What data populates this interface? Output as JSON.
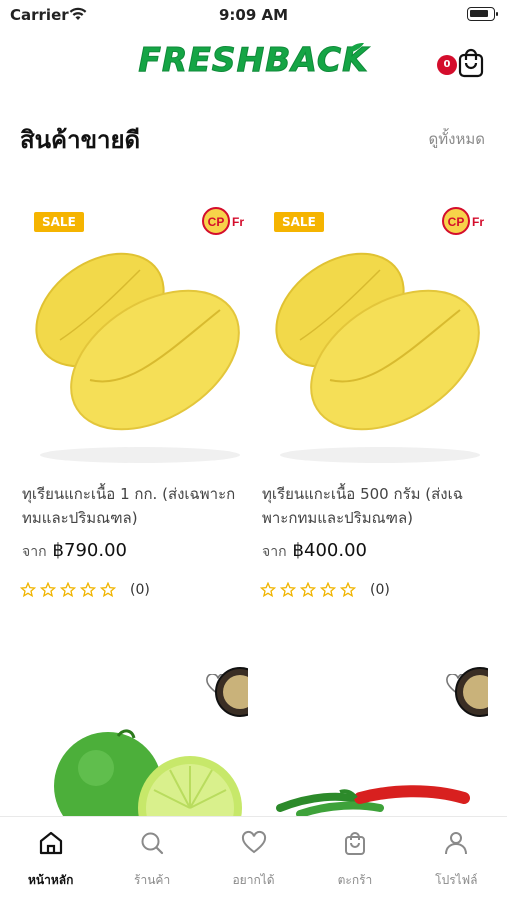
{
  "status_bar": {
    "carrier": "Carrier",
    "time": "9:09 AM"
  },
  "header": {
    "logo_text": "FRESHBACK",
    "cart_count": "0"
  },
  "section": {
    "title": "สินค้าขายดี",
    "see_all": "ดูทั้งหมด"
  },
  "products": [
    {
      "sale_label": "SALE",
      "brand_label": "CP",
      "name": "ทุเรียนแกะเนื้อ 1 กก. (ส่งเฉพาะกทมและปริมณฑล)",
      "price_prefix": "จาก",
      "price": "฿790.00",
      "rating_count": "(0)"
    },
    {
      "sale_label": "SALE",
      "brand_label": "CP",
      "name": "ทุเรียนแกะเนื้อ 500 กรัม (ส่งเฉพาะกทมและปริมณฑล)",
      "price_prefix": "จาก",
      "price": "฿400.00",
      "rating_count": "(0)"
    }
  ],
  "tabbar": {
    "items": [
      {
        "label": "หน้าหลัก",
        "icon": "home-icon",
        "active": true
      },
      {
        "label": "ร้านค้า",
        "icon": "search-icon",
        "active": false
      },
      {
        "label": "อยากได้",
        "icon": "heart-icon",
        "active": false
      },
      {
        "label": "ตะกร้า",
        "icon": "bag-icon",
        "active": false
      },
      {
        "label": "โปรไฟล์",
        "icon": "user-icon",
        "active": false
      }
    ]
  },
  "colors": {
    "brand_green": "#15a545",
    "sale": "#f5b400",
    "badge_red": "#d40d2c",
    "star": "#f0b400"
  }
}
